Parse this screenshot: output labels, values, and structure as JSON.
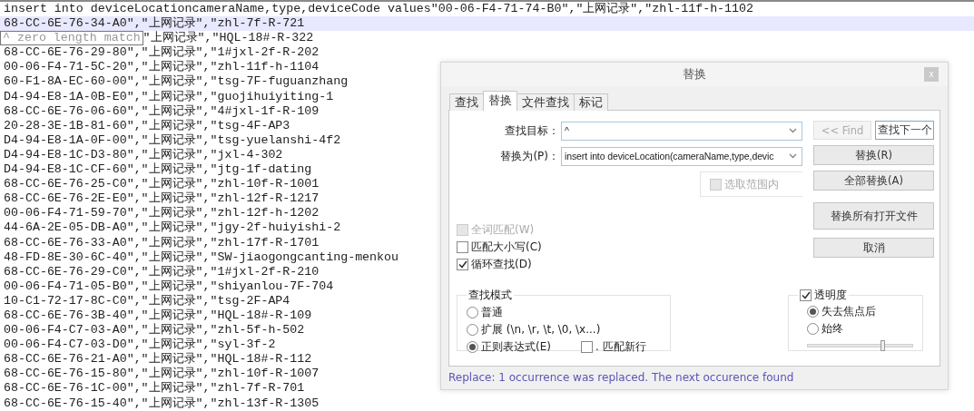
{
  "editor": {
    "lines": [
      {
        "text": "insert into deviceLocationcameraName,type,deviceCode values\"00-06-F4-71-74-B0\",\"上网记录\",\"zhl-11f-h-1102",
        "highlighted": false
      },
      {
        "text": "68-CC-6E-76-34-A0\",\"上网记录\",\"zhl-7f-R-721",
        "highlighted": true
      },
      {
        "tooltip": "^ zero length match",
        "text": "\"上网记录\",\"HQL-18#-R-322",
        "highlighted": false
      },
      {
        "text": "68-CC-6E-76-29-80\",\"上网记录\",\"1#jxl-2f-R-202",
        "highlighted": false
      },
      {
        "text": "00-06-F4-71-5C-20\",\"上网记录\",\"zhl-11f-h-1104",
        "highlighted": false
      },
      {
        "text": "60-F1-8A-EC-60-00\",\"上网记录\",\"tsg-7F-fuguanzhang",
        "highlighted": false
      },
      {
        "text": "D4-94-E8-1A-0B-E0\",\"上网记录\",\"guojihuiyiting-1",
        "highlighted": false
      },
      {
        "text": "68-CC-6E-76-06-60\",\"上网记录\",\"4#jxl-1f-R-109",
        "highlighted": false
      },
      {
        "text": "20-28-3E-1B-81-60\",\"上网记录\",\"tsg-4F-AP3",
        "highlighted": false
      },
      {
        "text": "D4-94-E8-1A-0F-00\",\"上网记录\",\"tsg-yuelanshi-4f2",
        "highlighted": false
      },
      {
        "text": "D4-94-E8-1C-D3-80\",\"上网记录\",\"jxl-4-302",
        "highlighted": false
      },
      {
        "text": "D4-94-E8-1C-CF-60\",\"上网记录\",\"jtg-1f-dating",
        "highlighted": false
      },
      {
        "text": "68-CC-6E-76-25-C0\",\"上网记录\",\"zhl-10f-R-1001",
        "highlighted": false
      },
      {
        "text": "68-CC-6E-76-2E-E0\",\"上网记录\",\"zhl-12f-R-1217",
        "highlighted": false
      },
      {
        "text": "00-06-F4-71-59-70\",\"上网记录\",\"zhl-12f-h-1202",
        "highlighted": false
      },
      {
        "text": "44-6A-2E-05-DB-A0\",\"上网记录\",\"jgy-2f-huiyishi-2",
        "highlighted": false
      },
      {
        "text": "68-CC-6E-76-33-A0\",\"上网记录\",\"zhl-17f-R-1701",
        "highlighted": false
      },
      {
        "text": "48-FD-8E-30-6C-40\",\"上网记录\",\"SW-jiaogongcanting-menkou",
        "highlighted": false
      },
      {
        "text": "68-CC-6E-76-29-C0\",\"上网记录\",\"1#jxl-2f-R-210",
        "highlighted": false
      },
      {
        "text": "00-06-F4-71-05-B0\",\"上网记录\",\"shiyanlou-7F-704",
        "highlighted": false
      },
      {
        "text": "10-C1-72-17-8C-C0\",\"上网记录\",\"tsg-2F-AP4",
        "highlighted": false
      },
      {
        "text": "68-CC-6E-76-3B-40\",\"上网记录\",\"HQL-18#-R-109",
        "highlighted": false
      },
      {
        "text": "00-06-F4-C7-03-A0\",\"上网记录\",\"zhl-5f-h-502",
        "highlighted": false
      },
      {
        "text": "00-06-F4-C7-03-D0\",\"上网记录\",\"syl-3f-2",
        "highlighted": false
      },
      {
        "text": "68-CC-6E-76-21-A0\",\"上网记录\",\"HQL-18#-R-112",
        "highlighted": false
      },
      {
        "text": "68-CC-6E-76-15-80\",\"上网记录\",\"zhl-10f-R-1007",
        "highlighted": false
      },
      {
        "text": "68-CC-6E-76-1C-00\",\"上网记录\",\"zhl-7f-R-701",
        "highlighted": false
      },
      {
        "text": "68-CC-6E-76-15-40\",\"上网记录\",\"zhl-13f-R-1305",
        "highlighted": false
      }
    ]
  },
  "dialog": {
    "title": "替换",
    "close": "x",
    "tabs": [
      {
        "label": "查找",
        "selected": false
      },
      {
        "label": "替换",
        "selected": true
      },
      {
        "label": "文件查找",
        "selected": false
      },
      {
        "label": "标记",
        "selected": false
      }
    ],
    "fields": [
      {
        "label": "查找目标：",
        "value": "^"
      },
      {
        "label": "替换为(P)：",
        "value": "insert into deviceLocation(cameraName,type,devic"
      }
    ],
    "in_selection": {
      "label": "选取范围内",
      "checked": false,
      "disabled": true
    },
    "buttons": [
      {
        "label": "<< Find",
        "disabled": true,
        "focused": false
      },
      {
        "label": "查找下一个",
        "disabled": false,
        "focused": true
      },
      {
        "label": "替换(R)",
        "disabled": false,
        "focused": false
      },
      {
        "label": "全部替换(A)",
        "disabled": false,
        "focused": false
      },
      {
        "label": "替换所有打开文件",
        "disabled": false,
        "focused": false
      },
      {
        "label": "取消",
        "disabled": false,
        "focused": false
      }
    ],
    "options": [
      {
        "label": "全词匹配(W)",
        "checked": false,
        "disabled": true
      },
      {
        "label": "匹配大小写(C)",
        "checked": false,
        "disabled": false
      },
      {
        "label": "循环查找(D)",
        "checked": true,
        "disabled": false
      }
    ],
    "search_mode": {
      "title": "查找模式",
      "options": [
        {
          "label": "普通",
          "selected": false
        },
        {
          "label": "扩展 (\\n, \\r, \\t, \\0, \\x...)",
          "selected": false
        },
        {
          "label": "正则表达式(E)",
          "selected": true
        }
      ],
      "dot_newline": {
        "label": ". 匹配新行",
        "checked": false
      }
    },
    "transparency": {
      "label": "透明度",
      "checked": true,
      "options": [
        {
          "label": "失去焦点后",
          "selected": true
        },
        {
          "label": "始终",
          "selected": false
        }
      ],
      "level": 0.71
    },
    "status": "Replace: 1 occurrence was replaced. The next occurence found"
  }
}
